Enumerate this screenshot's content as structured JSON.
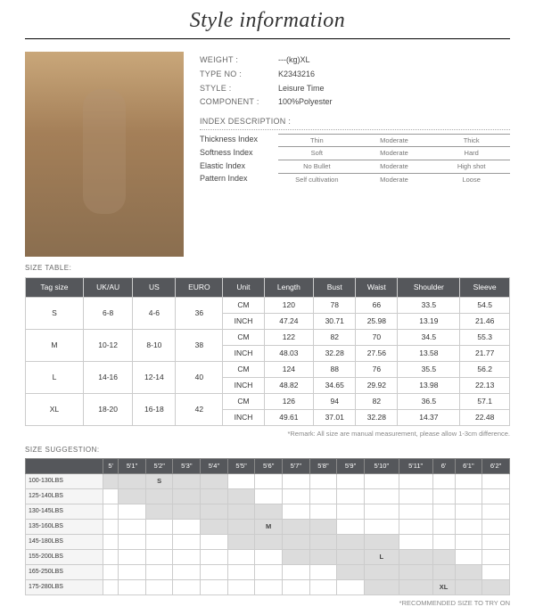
{
  "title": "Style information",
  "info": {
    "weight_k": "WEIGHT :",
    "weight_v": "---(kg)XL",
    "type_k": "TYPE NO :",
    "type_v": "K2343216",
    "style_k": "STYLE :",
    "style_v": "Leisure Time",
    "comp_k": "COMPONENT :",
    "comp_v": "100%Polyester",
    "idx_k": "INDEX DESCRIPTION :",
    "thk_k": "Thickness Index",
    "thk": [
      "Thin",
      "Moderate",
      "Thick"
    ],
    "sft_k": "Softness Index",
    "sft": [
      "Soft",
      "Moderate",
      "Hard"
    ],
    "ela_k": "Elastic Index",
    "ela": [
      "No Bullet",
      "Moderate",
      "High shot"
    ],
    "pat_k": "Pattern Index",
    "pat": [
      "Self cultivation",
      "Moderate",
      "Loose"
    ]
  },
  "sizehdr": "SIZE TABLE:",
  "sizecols": [
    "Tag size",
    "UK/AU",
    "US",
    "EURO",
    "Unit",
    "Length",
    "Bust",
    "Waist",
    "Shoulder",
    "Sleeve"
  ],
  "sizerows": [
    {
      "tag": "S",
      "uk": "6-8",
      "us": "4-6",
      "eu": "36",
      "cm": [
        "120",
        "78",
        "66",
        "33.5",
        "54.5"
      ],
      "in": [
        "47.24",
        "30.71",
        "25.98",
        "13.19",
        "21.46"
      ]
    },
    {
      "tag": "M",
      "uk": "10-12",
      "us": "8-10",
      "eu": "38",
      "cm": [
        "122",
        "82",
        "70",
        "34.5",
        "55.3"
      ],
      "in": [
        "48.03",
        "32.28",
        "27.56",
        "13.58",
        "21.77"
      ]
    },
    {
      "tag": "L",
      "uk": "14-16",
      "us": "12-14",
      "eu": "40",
      "cm": [
        "124",
        "88",
        "76",
        "35.5",
        "56.2"
      ],
      "in": [
        "48.82",
        "34.65",
        "29.92",
        "13.98",
        "22.13"
      ]
    },
    {
      "tag": "XL",
      "uk": "18-20",
      "us": "16-18",
      "eu": "42",
      "cm": [
        "126",
        "94",
        "82",
        "36.5",
        "57.1"
      ],
      "in": [
        "49.61",
        "37.01",
        "32.28",
        "14.37",
        "22.48"
      ]
    }
  ],
  "unit_cm": "CM",
  "unit_in": "INCH",
  "remark_size": "*Remark: All size are manual measurement, please allow 1-3cm difference.",
  "sugghdr": "SIZE SUGGESTION:",
  "heights": [
    "5'",
    "5'1\"",
    "5'2\"",
    "5'3\"",
    "5'4\"",
    "5'5\"",
    "5'6\"",
    "5'7\"",
    "5'8\"",
    "5'9\"",
    "5'10\"",
    "5'11\"",
    "6'",
    "6'1\"",
    "6'2\""
  ],
  "weights": [
    "100-130LBS",
    "125-140LBS",
    "130-145LBS",
    "135-160LBS",
    "145-180LBS",
    "155-200LBS",
    "165-250LBS",
    "175-280LBS"
  ],
  "slabels": {
    "S": "S",
    "M": "M",
    "L": "L",
    "XL": "XL"
  },
  "remark_sugg": "*RECOMMENDED SIZE TO TRY ON"
}
